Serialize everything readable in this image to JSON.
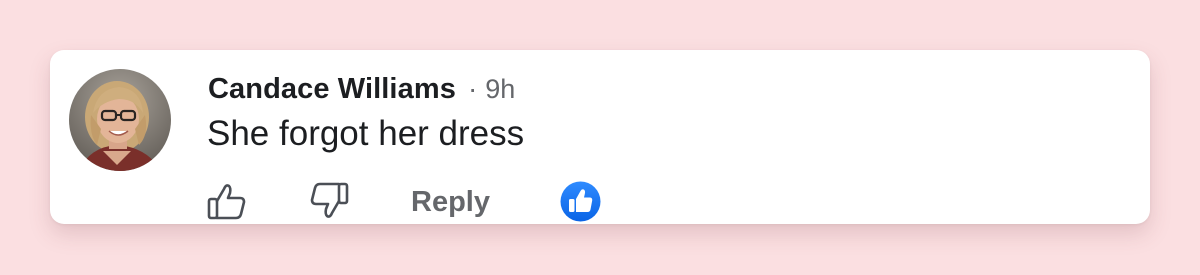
{
  "comment": {
    "author": "Candace Williams",
    "separator": "·",
    "time": "9h",
    "text": "She forgot her dress"
  },
  "actions": {
    "like_icon": "thumbs-up-outline-icon",
    "dislike_icon": "thumbs-down-outline-icon",
    "reply_label": "Reply",
    "reaction_icon": "blue-like-reaction-icon"
  },
  "colors": {
    "background": "#fbdfe1",
    "card": "#ffffff",
    "text_primary": "#1c1e21",
    "text_secondary": "#65676b",
    "reaction_blue": "#1877f2"
  }
}
